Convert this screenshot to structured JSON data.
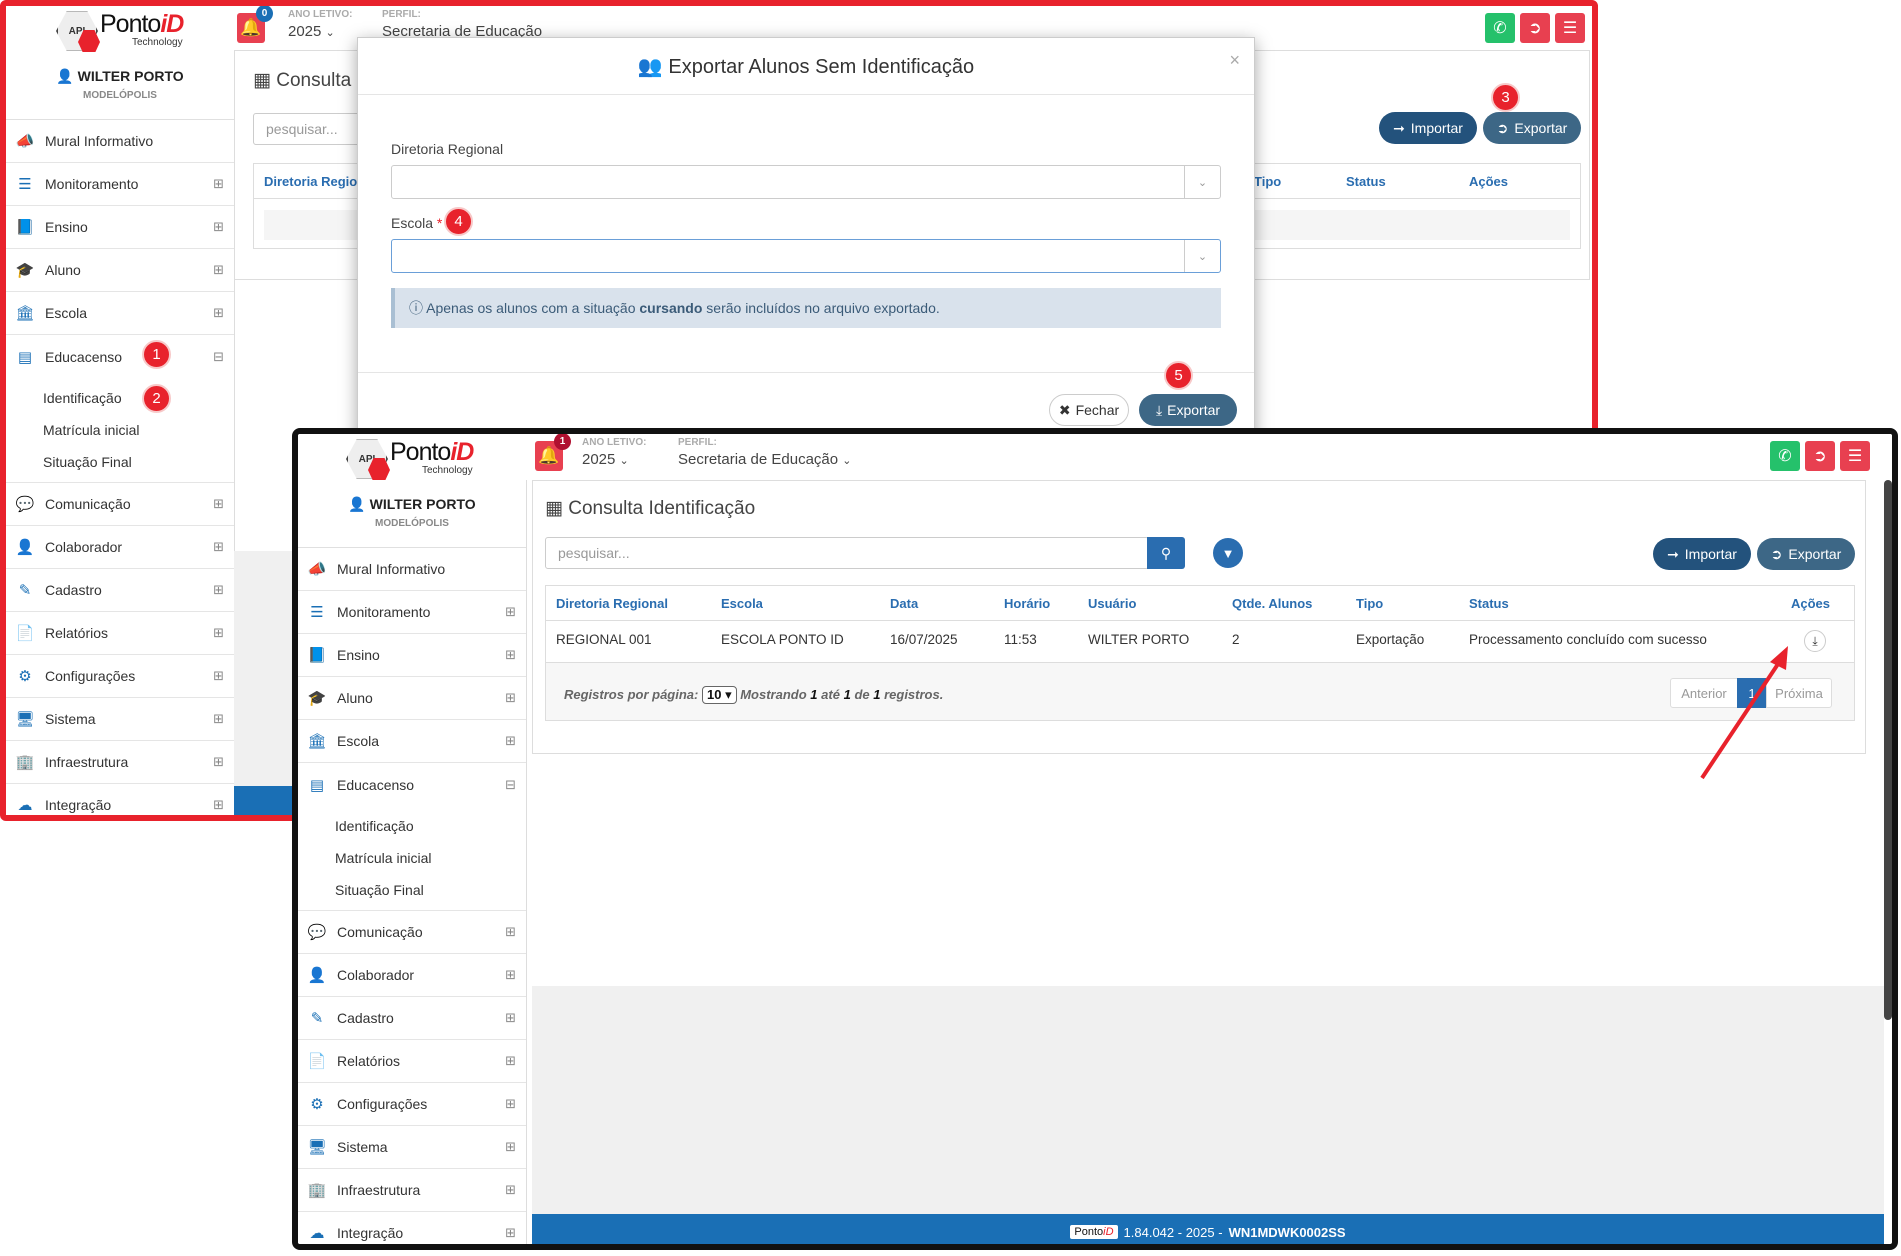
{
  "header": {
    "brand_prefix": "Ponto",
    "brand_suffix": "iD",
    "brand_tag": "Technology",
    "api_label": "API",
    "ano_letivo_label": "ANO LETIVO:",
    "ano_letivo_value": "2025",
    "perfil_label": "PERFIL:",
    "perfil_value": "Secretaria de Educação",
    "notif_count_a": "0",
    "notif_count_b": "1"
  },
  "user": {
    "name": "WILTER PORTO",
    "city": "MODELÓPOLIS"
  },
  "menu": {
    "items_top": [
      {
        "label": "Mural Informativo"
      },
      {
        "label": "Monitoramento"
      },
      {
        "label": "Ensino"
      },
      {
        "label": "Aluno"
      },
      {
        "label": "Escola"
      },
      {
        "label": "Educacenso"
      }
    ],
    "sub_items": [
      "Identificação",
      "Matrícula inicial",
      "Situação Final"
    ],
    "items_bottom": [
      {
        "label": "Comunicação"
      },
      {
        "label": "Colaborador"
      },
      {
        "label": "Cadastro"
      },
      {
        "label": "Relatórios"
      },
      {
        "label": "Configurações"
      },
      {
        "label": "Sistema"
      },
      {
        "label": "Infraestrutura"
      },
      {
        "label": "Integração"
      }
    ]
  },
  "page": {
    "title": "Consulta Identificação",
    "title_short": "Consulta I",
    "search_placeholder": "pesquisar...",
    "import_label": "Importar",
    "export_label": "Exportar"
  },
  "table": {
    "columns": [
      "Diretoria Regional",
      "Escola",
      "Data",
      "Horário",
      "Usuário",
      "Qtde. Alunos",
      "Tipo",
      "Status",
      "Ações"
    ],
    "col_short": "Diretoria Regio",
    "rows": [
      {
        "regional": "REGIONAL 001",
        "escola": "ESCOLA PONTO ID",
        "data": "16/07/2025",
        "horario": "11:53",
        "usuario": "WILTER PORTO",
        "qtde": "2",
        "tipo": "Exportação",
        "status": "Processamento concluído com sucesso"
      }
    ],
    "footer": {
      "per_page_label": "Registros por página:",
      "per_page_value": "10",
      "showing_1": "Mostrando",
      "from": "1",
      "ate": "até",
      "to": "1",
      "de": "de",
      "total": "1",
      "registros": "registros."
    },
    "pager": {
      "prev": "Anterior",
      "page": "1",
      "next": "Próxima"
    }
  },
  "modal": {
    "title": "Exportar Alunos Sem Identificação",
    "close_x": "×",
    "regional_label": "Diretoria Regional",
    "escola_label": "Escola",
    "required_mark": "*",
    "info_pre": "Apenas os alunos com a situação",
    "info_bold": "cursando",
    "info_post": "serão incluídos no arquivo exportado.",
    "close_button": "Fechar",
    "export_button": "Exportar"
  },
  "footer": {
    "version": "1.84.042 - 2025 -",
    "code": "WN1MDWK0002SS"
  },
  "steps": [
    "1",
    "2",
    "3",
    "4",
    "5"
  ],
  "colors": {
    "accent": "#1a6fb5",
    "dark_button": "#23527c",
    "danger": "#e8222c",
    "whatsapp": "#25c16b"
  }
}
